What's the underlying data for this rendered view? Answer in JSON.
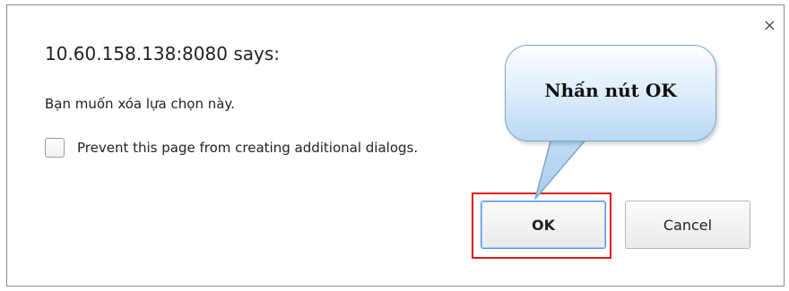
{
  "dialog": {
    "title": "10.60.158.138:8080 says:",
    "message": "Bạn muốn xóa lựa chọn này.",
    "checkbox_label": "Prevent this page from creating additional dialogs.",
    "checkbox_checked": false,
    "close_glyph": "×",
    "ok_label": "OK",
    "cancel_label": "Cancel"
  },
  "annotation": {
    "callout_text": "Nhấn nút OK",
    "highlight_color": "#e0141e"
  },
  "icons": {
    "close": "close-icon"
  },
  "colors": {
    "ok_focus_border": "#4d90fe",
    "callout_fill": "#d9ebfa"
  }
}
